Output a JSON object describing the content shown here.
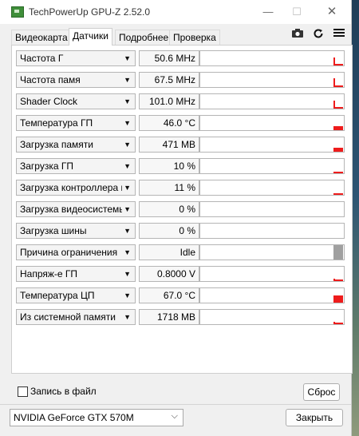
{
  "window": {
    "title": "TechPowerUp GPU-Z 2.52.0",
    "minimize_glyph": "—",
    "maximize_glyph": "☐",
    "close_glyph": "✕"
  },
  "tabs": [
    {
      "label": "Видеокарта",
      "active": false
    },
    {
      "label": "Датчики",
      "active": true
    },
    {
      "label": "Подробнее",
      "active": false
    },
    {
      "label": "Проверка",
      "active": false
    }
  ],
  "toolbar_icons": {
    "camera": "camera-icon",
    "refresh": "refresh-icon",
    "menu": "menu-icon"
  },
  "sensors": [
    {
      "label": "Частота Г",
      "value": "50.6 MHz",
      "level": 0.55,
      "graph": "spike"
    },
    {
      "label": "Частота памя",
      "value": "67.5 MHz",
      "level": 0.6,
      "graph": "spike"
    },
    {
      "label": "Shader Clock",
      "value": "101.0 MHz",
      "level": 0.55,
      "graph": "spike"
    },
    {
      "label": "Температура ГП",
      "value": "46.0 °C",
      "level": 0.3,
      "graph": "block"
    },
    {
      "label": "Загрузка памяти",
      "value": "471 MB",
      "level": 0.3,
      "graph": "block"
    },
    {
      "label": "Загрузка ГП",
      "value": "10 %",
      "level": 0.12,
      "graph": "block"
    },
    {
      "label": "Загрузка контроллера памяти",
      "value": "11 %",
      "level": 0.06,
      "graph": "block"
    },
    {
      "label": "Загрузка видеосистемы",
      "value": "0 %",
      "level": 0,
      "graph": "none"
    },
    {
      "label": "Загрузка шины",
      "value": "0 %",
      "level": 0,
      "graph": "none"
    },
    {
      "label": "Причина ограничения",
      "value": "Idle",
      "level": 1,
      "graph": "gray"
    },
    {
      "label": "Напряж-е ГП",
      "value": "0.8000 V",
      "level": 0.15,
      "graph": "spike"
    },
    {
      "label": "Температура ЦП",
      "value": "67.0 °C",
      "level": 0.5,
      "graph": "block"
    },
    {
      "label": "Из системной памяти",
      "value": "1718 MB",
      "level": 0.15,
      "graph": "spike"
    }
  ],
  "footer": {
    "log_checkbox_label": "Запись в файл",
    "log_checked": false,
    "reset_label": "Сброс",
    "gpu_selected": "NVIDIA GeForce GTX 570M",
    "close_label": "Закрыть"
  },
  "colors": {
    "graph_bar": "#ee1c1c",
    "limit_bar": "#a0a0a0"
  }
}
